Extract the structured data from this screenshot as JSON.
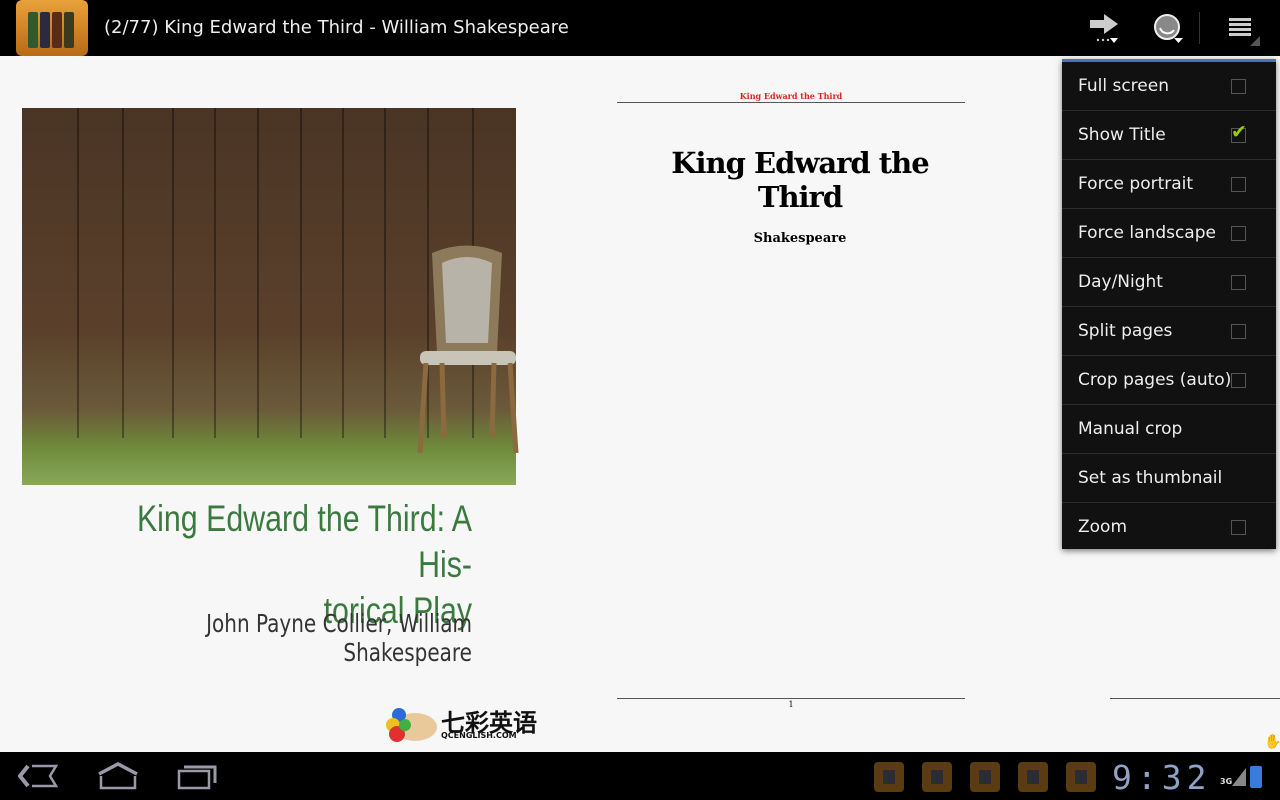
{
  "topbar": {
    "title": "(2/77) King Edward the Third - William Shakespeare",
    "icons": [
      "app-book-icon",
      "goto-page-icon",
      "search-icon",
      "menu-icon"
    ]
  },
  "cover": {
    "title": "King Edward the Third: A His-torical Play",
    "title_lines": [
      "King Edward the Third: A His-",
      "torical Play"
    ],
    "authors": "John Payne Collier, William Shakespeare",
    "logo_text": "七彩英语",
    "logo_sub": "QCENGLISH.COM",
    "title_color": "#3b7a3f"
  },
  "page": {
    "running_head": "King Edward the Third",
    "title": "King Edward the Third",
    "author": "Shakespeare",
    "page_number": "1"
  },
  "menu": {
    "accent": "#4a74b8",
    "items": [
      {
        "label": "Full screen",
        "checkbox": true,
        "checked": false
      },
      {
        "label": "Show Title",
        "checkbox": true,
        "checked": true
      },
      {
        "label": "Force portrait",
        "checkbox": true,
        "checked": false
      },
      {
        "label": "Force landscape",
        "checkbox": true,
        "checked": false
      },
      {
        "label": "Day/Night",
        "checkbox": true,
        "checked": false
      },
      {
        "label": "Split pages",
        "checkbox": true,
        "checked": false
      },
      {
        "label": "Crop pages (auto)",
        "checkbox": true,
        "checked": false
      },
      {
        "label": "Manual crop",
        "checkbox": false
      },
      {
        "label": "Set as thumbnail",
        "checkbox": false
      },
      {
        "label": "Zoom",
        "checkbox": true,
        "checked": false
      }
    ]
  },
  "statusbar": {
    "time": "9:32",
    "network": "3G",
    "nav": [
      "back-icon",
      "home-icon",
      "recent-apps-icon"
    ]
  }
}
